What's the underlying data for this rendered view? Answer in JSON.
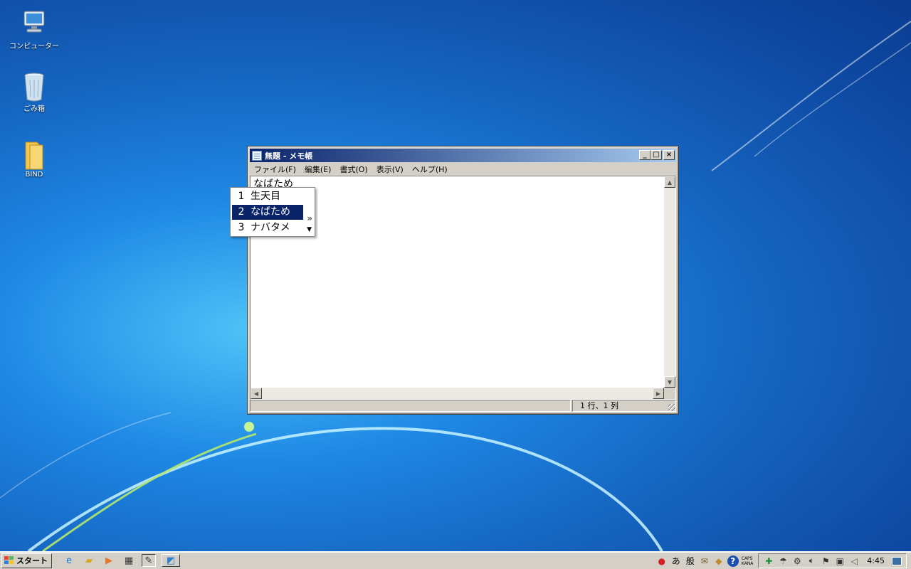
{
  "desktop": {
    "icons": [
      {
        "label": "コンピューター",
        "icon": "computer-icon"
      },
      {
        "label": "ごみ箱",
        "icon": "recycle-bin-icon"
      },
      {
        "label": "BIND",
        "icon": "folder-icon"
      }
    ]
  },
  "notepad": {
    "title": "無題 - メモ帳",
    "menu": [
      "ファイル(F)",
      "編集(E)",
      "書式(O)",
      "表示(V)",
      "ヘルプ(H)"
    ],
    "text": "なばため",
    "status_position": "1 行、1 列"
  },
  "ime": {
    "candidates": [
      {
        "num": "1",
        "text": "生天目"
      },
      {
        "num": "2",
        "text": "なばため"
      },
      {
        "num": "3",
        "text": "ナバタメ"
      }
    ],
    "selected_index": 1,
    "more_glyph": "»",
    "down_glyph": "▼"
  },
  "taskbar": {
    "start_label": "スタート",
    "quick_launch": [
      "ie-icon",
      "explorer-icon",
      "media-player-icon",
      "clapper-icon",
      "notepad-task-icon",
      "window-task-icon"
    ],
    "ime_mode": "あ",
    "ime_dict": "般",
    "caps_label": "CAPS",
    "kana_label": "KANA",
    "clock": "4:45"
  },
  "colors": {
    "title_active_start": "#0a246a",
    "title_active_end": "#a6caf0",
    "selection": "#0a246a",
    "face": "#d4d0c8"
  }
}
